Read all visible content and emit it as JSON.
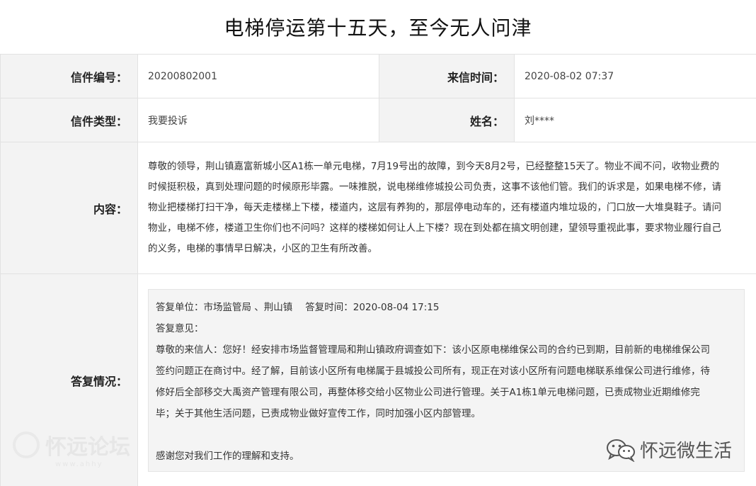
{
  "page": {
    "title": "电梯停运第十五天，至今无人问津"
  },
  "letter": {
    "number_label": "信件编号：",
    "number_value": "20200802001",
    "time_label": "来信时间：",
    "time_value": "2020-08-02 07:37",
    "type_label": "信件类型：",
    "type_value": "我要投诉",
    "name_label": "姓名：",
    "name_value": "刘****",
    "content_label": "内容：",
    "content_lines": [
      "尊敬的领导，荆山镇嘉富新城小区A1栋一单元电梯，7月19号出的故障，到今天8月2号，已经整整15天了。物业不闻不问，收物业费的",
      "时候挺积极，真到处理问题的时候原形毕露。一味推脱，说电梯维修城投公司负责，这事不该他们管。我们的诉求是，如果电梯不修，请",
      "物业把楼梯打扫干净，每天走楼梯上下楼，楼道内，这层有养狗的，那层停电动车的，还有楼道内堆垃圾的，门口放一大堆臭鞋子。请问",
      "物业，电梯不修，楼道卫生你们也不问吗？这样的楼梯如何让人上下楼？现在到处都在搞文明创建，望领导重视此事，要求物业履行自己",
      "的义务，电梯的事情早日解决，小区的卫生有所改善。"
    ]
  },
  "reply": {
    "label": "答复情况：",
    "unit_label": "答复单位：",
    "unit_value": "市场监管局 、荆山镇",
    "time_label": "答复时间：",
    "time_value": "2020-08-04 17:15",
    "opinion_label": "答复意见：",
    "lines": [
      "尊敬的来信人：您好！经安排市场监督管理局和荆山镇政府调查如下：该小区原电梯维保公司的合约已到期，目前新的电梯维保公司",
      "签约问题正在商讨中。经了解，目前该小区所有电梯属于县城投公司所有，现正在对该小区所有问题电梯联系维保公司进行维修，待",
      "修好后全部移交大禹资产管理有限公司，再整体移交给小区物业公司进行管理。关于A1栋1单元电梯问题，已责成物业近期维修完",
      "毕；关于其他生活问题，已责成物业做好宣传工作，同时加强小区内部管理。"
    ],
    "closing": "感谢您对我们工作的理解和支持。"
  },
  "watermarks": {
    "left": "怀远论坛",
    "left_sub": "www.ahhy",
    "right": "怀远微生活",
    "right_icon": "wechat-icon"
  }
}
